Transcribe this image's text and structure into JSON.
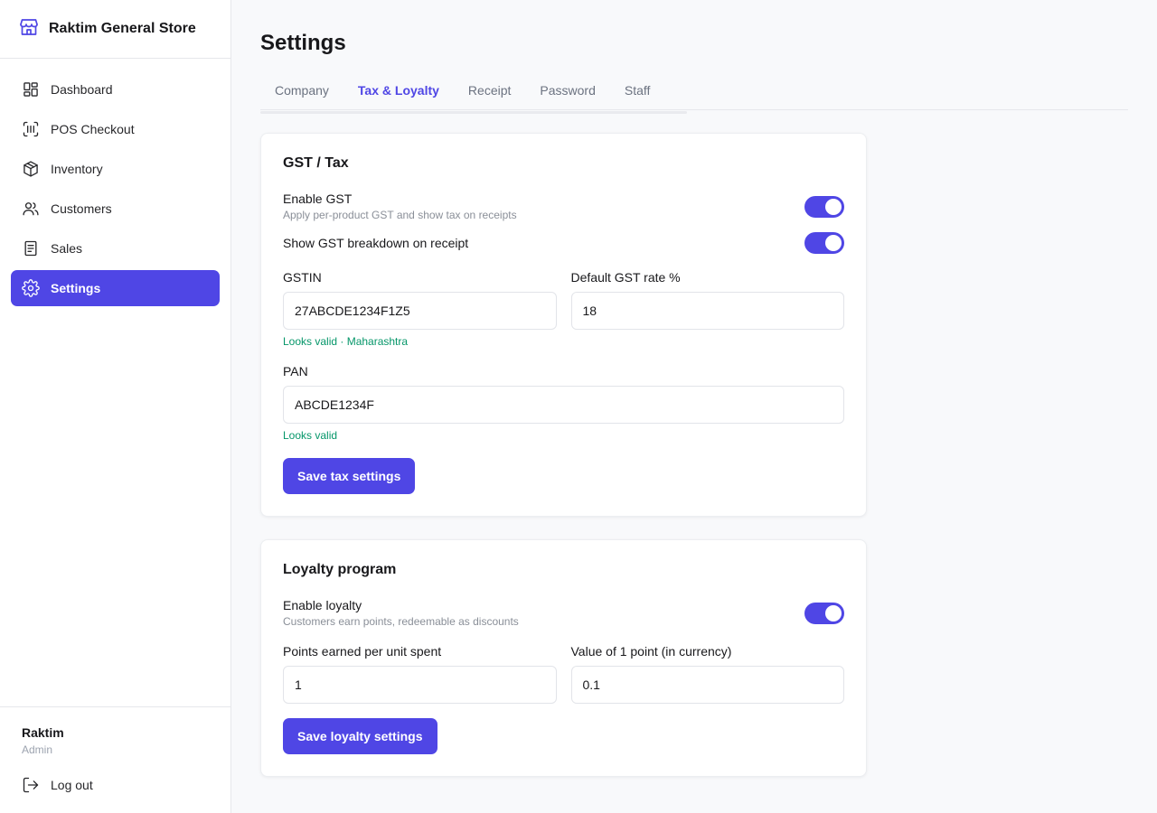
{
  "app": {
    "brand_name": "Raktim General Store"
  },
  "sidebar": {
    "items": [
      {
        "label": "Dashboard",
        "icon": "dashboard-icon"
      },
      {
        "label": "POS Checkout",
        "icon": "barcode-scan-icon"
      },
      {
        "label": "Inventory",
        "icon": "box-icon"
      },
      {
        "label": "Customers",
        "icon": "users-icon"
      },
      {
        "label": "Sales",
        "icon": "receipt-icon"
      },
      {
        "label": "Settings",
        "icon": "gear-icon",
        "active": true
      }
    ],
    "user": {
      "name": "Raktim",
      "role": "Admin"
    },
    "logout_label": "Log out"
  },
  "page": {
    "title": "Settings",
    "tabs": [
      {
        "label": "Company"
      },
      {
        "label": "Tax & Loyalty",
        "active": true
      },
      {
        "label": "Receipt"
      },
      {
        "label": "Password"
      },
      {
        "label": "Staff"
      }
    ]
  },
  "tax": {
    "title": "GST / Tax",
    "enable_gst": {
      "label": "Enable GST",
      "description": "Apply per-product GST and show tax on receipts",
      "on": true
    },
    "breakdown": {
      "label": "Show GST breakdown on receipt",
      "on": true
    },
    "gstin": {
      "label": "GSTIN",
      "value": "27ABCDE1234F1Z5",
      "hint": "Looks valid · Maharashtra"
    },
    "gst_rate": {
      "label": "Default GST rate %",
      "value": "18"
    },
    "pan": {
      "label": "PAN",
      "value": "ABCDE1234F",
      "hint": "Looks valid"
    },
    "save_label": "Save tax settings"
  },
  "loyalty": {
    "title": "Loyalty program",
    "enable": {
      "label": "Enable loyalty",
      "description": "Customers earn points, redeemable as discounts",
      "on": true
    },
    "points_per_unit": {
      "label": "Points earned per unit spent",
      "value": "1"
    },
    "point_value": {
      "label": "Value of 1 point (in currency)",
      "value": "0.1"
    },
    "save_label": "Save loyalty settings"
  },
  "colors": {
    "accent": "#4f46e5",
    "valid_hint": "#059669"
  }
}
